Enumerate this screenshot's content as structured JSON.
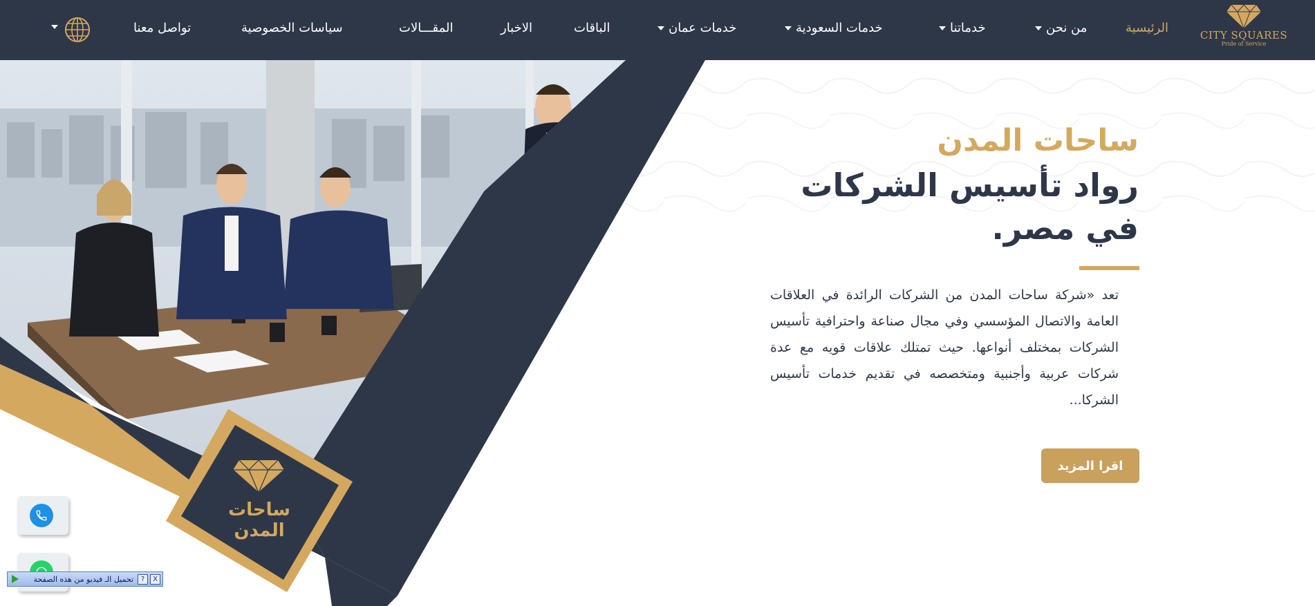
{
  "nav": {
    "logo": {
      "title": "CITY SQUARES",
      "tagline": "Pride of Service"
    },
    "items": [
      {
        "label": "الرئيسية",
        "active": true
      },
      {
        "label": "من نحن",
        "dropdown": true
      },
      {
        "label": "خدماتنا",
        "dropdown": true
      },
      {
        "label": "خدمات السعودية",
        "dropdown": true
      },
      {
        "label": "خدمات عمان",
        "dropdown": true
      },
      {
        "label": "الباقات"
      },
      {
        "label": "الاخبار"
      },
      {
        "label": "المقـــالات"
      },
      {
        "label": "سياسات الخصوصية"
      },
      {
        "label": "تواصل معنا"
      }
    ],
    "language_icon": "globe-icon"
  },
  "hero": {
    "title_line1": "ساحات المدن",
    "title_line2": "رواد تأسيس الشركات في مصر.",
    "description": "تعد «شركة ساحات المدن من الشركات الرائدة في العلاقات العامة والاتصال المؤسسي وفي مجال صناعة واحترافية تأسيس الشركات بمختلف أنواعها. حيث تمتلك علاقات قويه مع عدة شركات عربية وأجنبية ومتخصصه في تقديم خدمات تأسيس الشركا...",
    "read_more": "اقرا المزيد",
    "badge_text": "ساحات المدن"
  },
  "floating": {
    "phone_icon": "phone-icon",
    "whatsapp_icon": "whatsapp-icon"
  },
  "video_bar": {
    "text": "تحميل الـ فيديو من هذه الصفحة",
    "help": "?",
    "close": "X"
  },
  "colors": {
    "navy": "#2e3748",
    "gold": "#d4a85f",
    "button_gold": "#c9a05c",
    "phone_blue": "#1e90e6",
    "whatsapp_green": "#25d366"
  }
}
